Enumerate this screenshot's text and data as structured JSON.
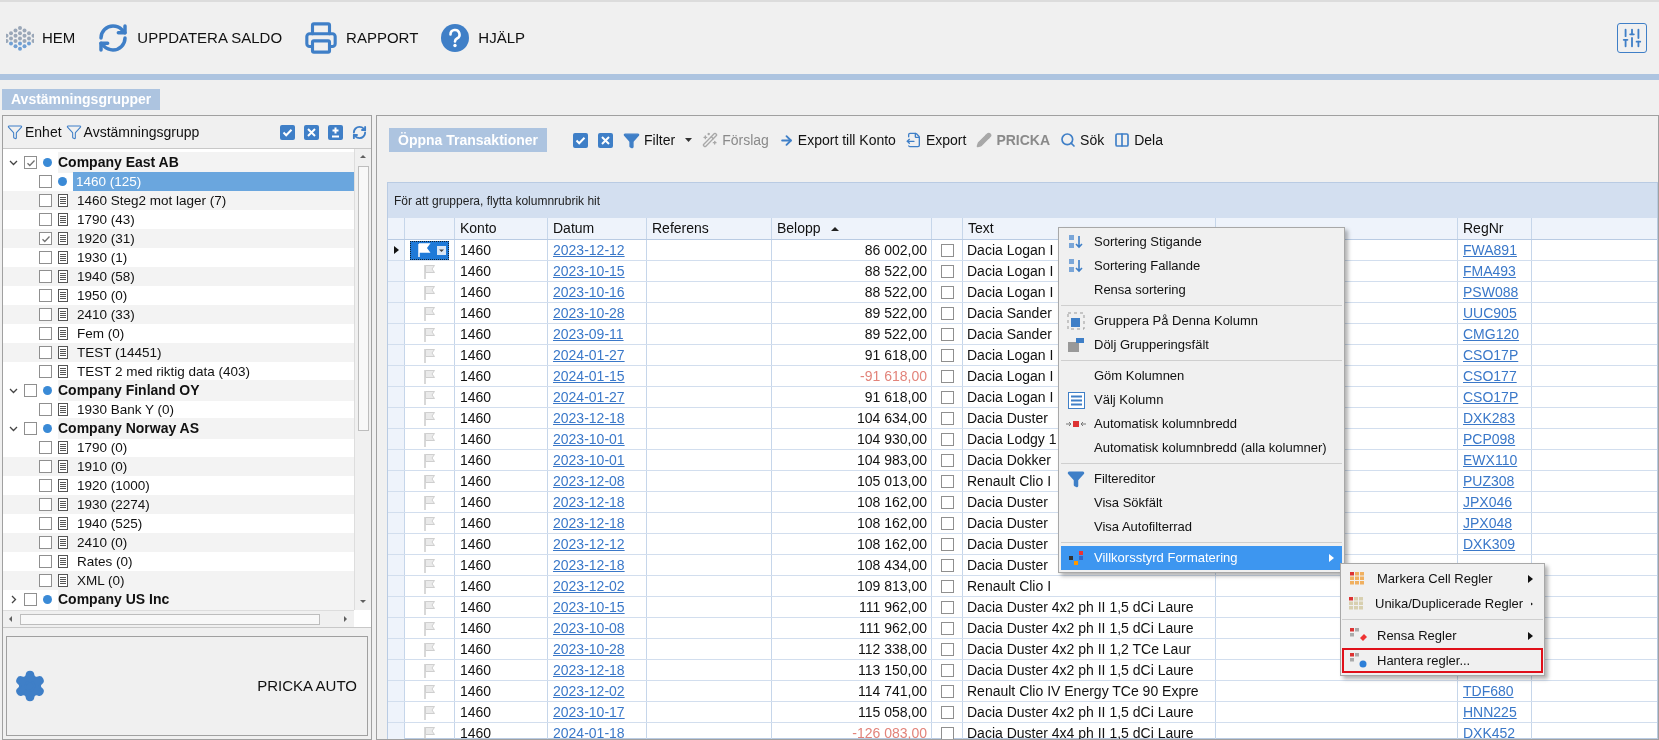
{
  "toolbar": {
    "buttons": [
      {
        "label": "HEM"
      },
      {
        "label": "UPPDATERA SALDO"
      },
      {
        "label": "RAPPORT"
      },
      {
        "label": "HJÄLP"
      }
    ]
  },
  "left_panel": {
    "title": "Avstämningsgrupper",
    "filters": [
      "Enhet",
      "Avstämningsgrupp"
    ],
    "tree": [
      {
        "name": "Company East AB",
        "checked": true,
        "expanded": true,
        "children": [
          {
            "label": "1460 (125)",
            "checked": false,
            "selected": true
          },
          {
            "label": "1460 Steg2 mot lager (7)",
            "checked": false,
            "selected": false
          },
          {
            "label": "1790 (43)",
            "checked": false,
            "selected": false
          },
          {
            "label": "1920 (31)",
            "checked": true,
            "selected": false
          },
          {
            "label": "1930 (1)",
            "checked": false,
            "selected": false
          },
          {
            "label": "1940 (58)",
            "checked": false,
            "selected": false
          },
          {
            "label": "1950 (0)",
            "checked": false,
            "selected": false
          },
          {
            "label": "2410 (33)",
            "checked": false,
            "selected": false
          },
          {
            "label": "Fem (0)",
            "checked": false,
            "selected": false
          },
          {
            "label": "TEST (14451)",
            "checked": false,
            "selected": false
          },
          {
            "label": "TEST 2 med riktig data (403)",
            "checked": false,
            "selected": false
          }
        ]
      },
      {
        "name": "Company Finland OY",
        "checked": false,
        "expanded": true,
        "children": [
          {
            "label": "1930 Bank Y (0)",
            "checked": false,
            "selected": false
          }
        ]
      },
      {
        "name": "Company Norway AS",
        "checked": false,
        "expanded": true,
        "children": [
          {
            "label": "1790 (0)",
            "checked": false,
            "selected": false
          },
          {
            "label": "1910 (0)",
            "checked": false,
            "selected": false
          },
          {
            "label": "1920 (1000)",
            "checked": false,
            "selected": false
          },
          {
            "label": "1930 (2274)",
            "checked": false,
            "selected": false
          },
          {
            "label": "1940 (525)",
            "checked": false,
            "selected": false
          },
          {
            "label": "2410 (0)",
            "checked": false,
            "selected": false
          },
          {
            "label": "Rates (0)",
            "checked": false,
            "selected": false
          },
          {
            "label": "XML (0)",
            "checked": false,
            "selected": false
          }
        ]
      },
      {
        "name": "Company US Inc",
        "checked": false,
        "expanded": false
      }
    ],
    "auto_button": "PRICKA AUTO"
  },
  "transactions": {
    "title": "Öppna Transaktioner",
    "tools": [
      {
        "label": "Filter",
        "kind": "dropdown",
        "disabled": false,
        "bold": false
      },
      {
        "label": "Förslag",
        "kind": "button",
        "disabled": true,
        "bold": false
      },
      {
        "label": "Export till Konto",
        "kind": "button",
        "disabled": false,
        "bold": false
      },
      {
        "label": "Export",
        "kind": "button",
        "disabled": false,
        "bold": false
      },
      {
        "label": "PRICKA",
        "kind": "button",
        "disabled": true,
        "bold": true
      },
      {
        "label": "Sök",
        "kind": "button",
        "disabled": false,
        "bold": false
      },
      {
        "label": "Dela",
        "kind": "button",
        "disabled": false,
        "bold": false
      }
    ],
    "group_hint": "För att gruppera, flytta kolumnrubrik hit",
    "columns": [
      {
        "label": "Konto",
        "sorted": false
      },
      {
        "label": "Datum",
        "sorted": false
      },
      {
        "label": "Referens",
        "sorted": false
      },
      {
        "label": "Belopp",
        "sorted": true
      },
      {
        "label": "Text",
        "sorted": false
      },
      {
        "label": "RegNr",
        "sorted": false
      }
    ],
    "rows": [
      {
        "selected": true,
        "konto": "1460",
        "datum": "2023-12-12",
        "belopp": "86 002,00",
        "negative": false,
        "checked": false,
        "text": "Dacia Logan I",
        "regnr": "FWA891"
      },
      {
        "selected": false,
        "konto": "1460",
        "datum": "2023-10-15",
        "belopp": "88 522,00",
        "negative": false,
        "checked": false,
        "text": "Dacia Logan I",
        "regnr": "FMA493"
      },
      {
        "selected": false,
        "konto": "1460",
        "datum": "2023-10-16",
        "belopp": "88 522,00",
        "negative": false,
        "checked": false,
        "text": "Dacia Logan I",
        "regnr": "PSW088"
      },
      {
        "selected": false,
        "konto": "1460",
        "datum": "2023-10-28",
        "belopp": "89 522,00",
        "negative": false,
        "checked": false,
        "text": "Dacia Sander",
        "regnr": "UUC905"
      },
      {
        "selected": false,
        "konto": "1460",
        "datum": "2023-09-11",
        "belopp": "89 522,00",
        "negative": false,
        "checked": false,
        "text": "Dacia Sander",
        "regnr": "CMG120"
      },
      {
        "selected": false,
        "konto": "1460",
        "datum": "2024-01-27",
        "belopp": "91 618,00",
        "negative": false,
        "checked": false,
        "text": "Dacia Logan I",
        "regnr": "CSO17P"
      },
      {
        "selected": false,
        "konto": "1460",
        "datum": "2024-01-15",
        "belopp": "-91 618,00",
        "negative": true,
        "checked": false,
        "text": "Dacia Logan I",
        "regnr": "CSO177"
      },
      {
        "selected": false,
        "konto": "1460",
        "datum": "2024-01-27",
        "belopp": "91 618,00",
        "negative": false,
        "checked": false,
        "text": "Dacia Logan I",
        "regnr": "CSO17P"
      },
      {
        "selected": false,
        "konto": "1460",
        "datum": "2023-12-18",
        "belopp": "104 634,00",
        "negative": false,
        "checked": false,
        "text": "Dacia Duster",
        "regnr": "DXK283"
      },
      {
        "selected": false,
        "konto": "1460",
        "datum": "2023-10-01",
        "belopp": "104 930,00",
        "negative": false,
        "checked": false,
        "text": "Dacia Lodgy 1",
        "regnr": "PCP098"
      },
      {
        "selected": false,
        "konto": "1460",
        "datum": "2023-10-01",
        "belopp": "104 983,00",
        "negative": false,
        "checked": false,
        "text": "Dacia Dokker",
        "regnr": "EWX110"
      },
      {
        "selected": false,
        "konto": "1460",
        "datum": "2023-12-08",
        "belopp": "105 013,00",
        "negative": false,
        "checked": false,
        "text": "Renault Clio I",
        "regnr": "PUZ308"
      },
      {
        "selected": false,
        "konto": "1460",
        "datum": "2023-12-18",
        "belopp": "108 162,00",
        "negative": false,
        "checked": false,
        "text": "Dacia Duster",
        "regnr": "JPX046"
      },
      {
        "selected": false,
        "konto": "1460",
        "datum": "2023-12-18",
        "belopp": "108 162,00",
        "negative": false,
        "checked": false,
        "text": "Dacia Duster",
        "regnr": "JPX048"
      },
      {
        "selected": false,
        "konto": "1460",
        "datum": "2023-12-12",
        "belopp": "108 162,00",
        "negative": false,
        "checked": false,
        "text": "Dacia Duster",
        "regnr": "DXK309"
      },
      {
        "selected": false,
        "konto": "1460",
        "datum": "2023-12-18",
        "belopp": "108 434,00",
        "negative": false,
        "checked": false,
        "text": "Dacia Duster"
      },
      {
        "selected": false,
        "konto": "1460",
        "datum": "2023-12-02",
        "belopp": "109 813,00",
        "negative": false,
        "checked": false,
        "text": "Renault Clio I"
      },
      {
        "selected": false,
        "konto": "1460",
        "datum": "2023-10-15",
        "belopp": "111 962,00",
        "negative": false,
        "checked": false,
        "text": "Dacia Duster 4x2 ph II 1,5 dCi Laure"
      },
      {
        "selected": false,
        "konto": "1460",
        "datum": "2023-10-08",
        "belopp": "111 962,00",
        "negative": false,
        "checked": false,
        "text": "Dacia Duster 4x2 ph II 1,5 dCi Laure"
      },
      {
        "selected": false,
        "konto": "1460",
        "datum": "2023-10-28",
        "belopp": "112 338,00",
        "negative": false,
        "checked": false,
        "text": "Dacia Duster 4x2 ph II 1,2 TCe Laur"
      },
      {
        "selected": false,
        "konto": "1460",
        "datum": "2023-12-18",
        "belopp": "113 150,00",
        "negative": false,
        "checked": false,
        "text": "Dacia Duster 4x2 ph II 1,5 dCi Laure"
      },
      {
        "selected": false,
        "konto": "1460",
        "datum": "2023-12-02",
        "belopp": "114 741,00",
        "negative": false,
        "checked": false,
        "text": "Renault Clio IV Energy TCe 90 Expre",
        "regnr": "TDF680"
      },
      {
        "selected": false,
        "konto": "1460",
        "datum": "2023-10-17",
        "belopp": "115 058,00",
        "negative": false,
        "checked": false,
        "text": "Dacia Duster 4x2 ph II 1,5 dCi Laure",
        "regnr": "HNN225"
      },
      {
        "selected": false,
        "konto": "1460",
        "datum": "2024-01-18",
        "belopp": "-126 083,00",
        "negative": true,
        "checked": false,
        "text": "Dacia Duster 4x4 ph II 1,5 dCi Laure",
        "regnr": "DXK452"
      }
    ]
  },
  "context_menu": {
    "sections": [
      [
        {
          "label": "Sortering Stigande",
          "highlighted": false,
          "submenu": false
        },
        {
          "label": "Sortering Fallande",
          "highlighted": false,
          "submenu": false
        },
        {
          "label": "Rensa sortering",
          "highlighted": false,
          "submenu": false
        }
      ],
      [
        {
          "label": "Gruppera På Denna Kolumn",
          "highlighted": false,
          "submenu": false
        },
        {
          "label": "Dölj Grupperingsfält",
          "highlighted": false,
          "submenu": false
        }
      ],
      [
        {
          "label": "Göm Kolumnen",
          "highlighted": false,
          "submenu": false
        },
        {
          "label": "Välj Kolumn",
          "highlighted": false,
          "submenu": false
        },
        {
          "label": "Automatisk kolumnbredd",
          "highlighted": false,
          "submenu": false
        },
        {
          "label": "Automatisk kolumnbredd (alla kolumner)",
          "highlighted": false,
          "submenu": false
        }
      ],
      [
        {
          "label": "Filtereditor",
          "highlighted": false,
          "submenu": false
        },
        {
          "label": "Visa Sökfält",
          "highlighted": false,
          "submenu": false
        },
        {
          "label": "Visa Autofilterrad",
          "highlighted": false,
          "submenu": false
        }
      ],
      [
        {
          "label": "Villkorsstyrd Formatering",
          "highlighted": true,
          "submenu": true
        }
      ]
    ]
  },
  "submenu": {
    "sections": [
      [
        {
          "label": "Markera Cell Regler",
          "submenu": true,
          "marked": false
        },
        {
          "label": "Unika/Duplicerade Regler",
          "submenu": true,
          "marked": false
        }
      ],
      [
        {
          "label": "Rensa Regler",
          "submenu": true,
          "marked": false
        },
        {
          "label": "Hantera regler...",
          "submenu": false,
          "marked": true
        }
      ]
    ]
  }
}
